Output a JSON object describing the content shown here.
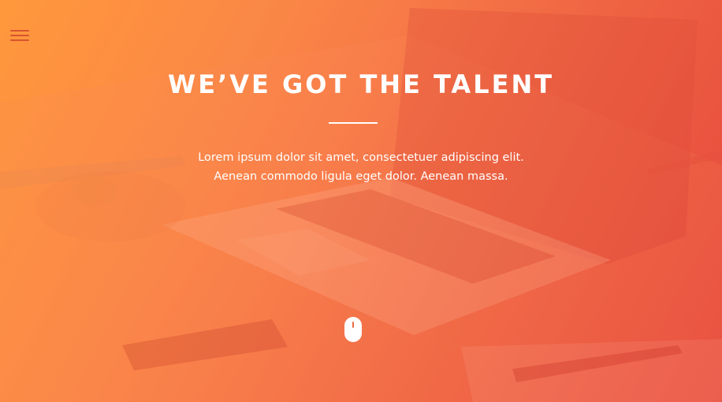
{
  "hero": {
    "title": "WE’VE GOT THE TALENT",
    "subtitle_line1": "Lorem ipsum dolor sit amet, consectetuer adipiscing elit.",
    "subtitle_line2": "Aenean commodo ligula eget dolor. Aenean massa."
  },
  "icons": {
    "menu": "hamburger-menu-icon",
    "scroll": "mouse-scroll-icon"
  },
  "colors": {
    "gradient_start": "#ff9a3c",
    "gradient_end": "#e4493d",
    "menu_icon": "#d8542f",
    "text": "#ffffff"
  }
}
